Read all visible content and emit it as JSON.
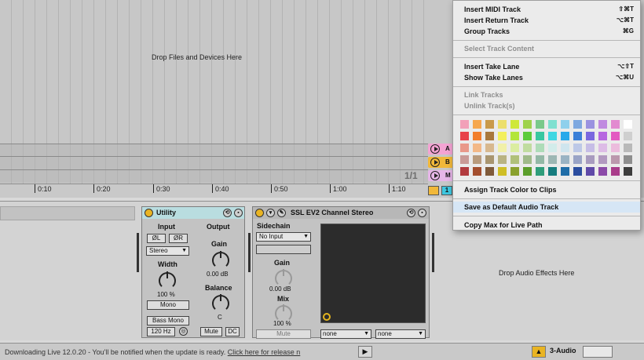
{
  "arrangement": {
    "drop_text": "Drop Files and Devices Here",
    "ratio": "1/1",
    "ruler_ticks": [
      "0:10",
      "0:20",
      "0:30",
      "0:40",
      "0:50",
      "1:00",
      "1:10"
    ],
    "track_heads": [
      {
        "letter": "A",
        "color": "#f4a3d3"
      },
      {
        "letter": "B",
        "color": "#f1b83a"
      },
      {
        "letter": "M",
        "color": "#e6b6e8"
      }
    ],
    "master_label": "1"
  },
  "utility": {
    "title": "Utility",
    "input_label": "Input",
    "output_label": "Output",
    "phase_left": "ØL",
    "phase_right": "ØR",
    "stereo_value": "Stereo",
    "width_label": "Width",
    "width_value": "100 %",
    "width_level_percent": 100,
    "mono_label": "Mono",
    "bass_mono_label": "Bass Mono",
    "bass_freq": "120 Hz",
    "gain_label": "Gain",
    "gain_value": "0.00 dB",
    "balance_label": "Balance",
    "balance_value": "C",
    "mute_label": "Mute",
    "dc_label": "DC"
  },
  "ssl": {
    "title": "SSL EV2 Channel Stereo",
    "sidechain_label": "Sidechain",
    "sidechain_value": "No Input",
    "gain_label": "Gain",
    "gain_value": "0.00 dB",
    "mix_label": "Mix",
    "mix_value": "100 %",
    "mute_label": "Mute",
    "none_left": "none",
    "none_right": "none"
  },
  "drop_audio_text": "Drop Audio Effects Here",
  "status": {
    "message": "Downloading Live 12.0.20 - You'll be notified when the update is ready.",
    "link": "Click here for release n",
    "track_name": "3-Audio"
  },
  "menu": {
    "insert_midi": {
      "label": "Insert MIDI Track",
      "shortcut": "⇧⌘T"
    },
    "insert_return": {
      "label": "Insert Return Track",
      "shortcut": "⌥⌘T"
    },
    "group_tracks": {
      "label": "Group Tracks",
      "shortcut": "⌘G"
    },
    "select_content": {
      "label": "Select Track Content"
    },
    "insert_take": {
      "label": "Insert Take Lane",
      "shortcut": "⌥⇧T"
    },
    "show_take": {
      "label": "Show Take Lanes",
      "shortcut": "⌥⌘U"
    },
    "link_tracks": {
      "label": "Link Tracks"
    },
    "unlink_tracks": {
      "label": "Unlink Track(s)"
    },
    "assign_color": {
      "label": "Assign Track Color to Clips"
    },
    "save_default": {
      "label": "Save as Default Audio Track"
    },
    "copy_max": {
      "label": "Copy Max for Live Path"
    },
    "palette": [
      [
        "#f2a0b8",
        "#f6a74d",
        "#c99a4a",
        "#ecdf6c",
        "#cfe83a",
        "#9ed24c",
        "#79c98a",
        "#7fe0d0",
        "#8fd0ec",
        "#7fa8e0",
        "#9a92e0",
        "#c08ae0",
        "#e28ad0",
        "#ffffff"
      ],
      [
        "#e8424a",
        "#f27d2a",
        "#a9783c",
        "#f3ef5c",
        "#b3e53a",
        "#5ccb3a",
        "#38c7a0",
        "#3fd7e2",
        "#28a9ea",
        "#3b7fd8",
        "#7a67df",
        "#b667e0",
        "#e359c1",
        "#cfcfcf"
      ],
      [
        "#e9988a",
        "#f3b887",
        "#d8b88e",
        "#f1f0a8",
        "#dbeda0",
        "#c0dca0",
        "#aedcb8",
        "#d2ecea",
        "#cfe5ee",
        "#bdc8e7",
        "#c6bde6",
        "#ddbce6",
        "#ecbcdd",
        "#b9b9b9"
      ],
      [
        "#c99a97",
        "#b89b7d",
        "#a9956f",
        "#b9b382",
        "#b0c07a",
        "#9fba8a",
        "#93b8a6",
        "#9db7b4",
        "#9ab3c3",
        "#9aa4c6",
        "#a89bbf",
        "#b299c0",
        "#bb98ad",
        "#8e8e8e"
      ],
      [
        "#b23b3f",
        "#a34e2e",
        "#7f5a3a",
        "#cfbe26",
        "#8aa12e",
        "#5b9e2b",
        "#2f9d7b",
        "#177d7f",
        "#1f6da8",
        "#2c4ea0",
        "#5f49a8",
        "#8b4aa8",
        "#a93c8a",
        "#3d3d3d"
      ]
    ]
  }
}
